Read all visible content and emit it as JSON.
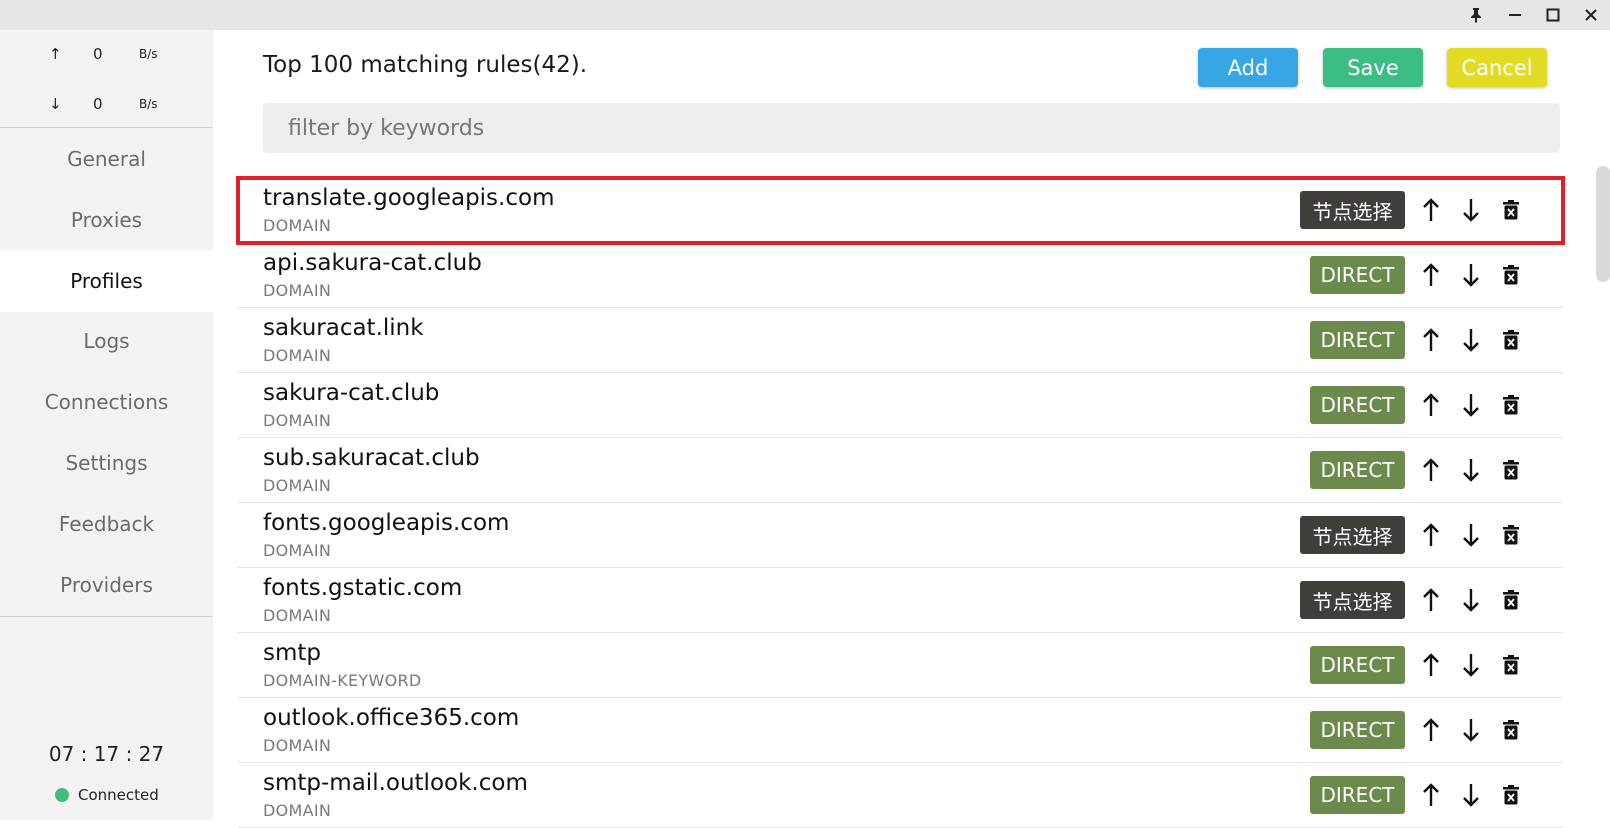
{
  "window": {
    "buttons": {
      "pin": "pin-icon",
      "minimize": "minimize-icon",
      "maximize": "maximize-icon",
      "close": "close-icon"
    }
  },
  "traffic": {
    "up": {
      "arrow": "↑",
      "value": "0",
      "unit": "B/s"
    },
    "down": {
      "arrow": "↓",
      "value": "0",
      "unit": "B/s"
    }
  },
  "nav": {
    "items": [
      "General",
      "Proxies",
      "Profiles",
      "Logs",
      "Connections",
      "Settings",
      "Feedback",
      "Providers"
    ],
    "active": "Profiles"
  },
  "footer": {
    "time": "07 : 17 : 27",
    "status": "Connected",
    "status_color": "#3fbf7a"
  },
  "header": {
    "title": "Top 100 matching rules(42).",
    "add_label": "Add",
    "save_label": "Save",
    "cancel_label": "Cancel",
    "add_color": "#36a7e4",
    "save_color": "#3dbd86",
    "cancel_color": "#e3dc24"
  },
  "search": {
    "placeholder": "filter by keywords",
    "value": ""
  },
  "rules": [
    {
      "payload": "translate.googleapis.com",
      "type": "DOMAIN",
      "policy": "节点选择",
      "highlighted": true
    },
    {
      "payload": "api.sakura-cat.club",
      "type": "DOMAIN",
      "policy": "DIRECT"
    },
    {
      "payload": "sakuracat.link",
      "type": "DOMAIN",
      "policy": "DIRECT"
    },
    {
      "payload": "sakura-cat.club",
      "type": "DOMAIN",
      "policy": "DIRECT"
    },
    {
      "payload": "sub.sakuracat.club",
      "type": "DOMAIN",
      "policy": "DIRECT"
    },
    {
      "payload": "fonts.googleapis.com",
      "type": "DOMAIN",
      "policy": "节点选择"
    },
    {
      "payload": "fonts.gstatic.com",
      "type": "DOMAIN",
      "policy": "节点选择"
    },
    {
      "payload": "smtp",
      "type": "DOMAIN-KEYWORD",
      "policy": "DIRECT"
    },
    {
      "payload": "outlook.office365.com",
      "type": "DOMAIN",
      "policy": "DIRECT"
    },
    {
      "payload": "smtp-mail.outlook.com",
      "type": "DOMAIN",
      "policy": "DIRECT"
    }
  ],
  "colors": {
    "direct": "#6b8a4b",
    "node": "#403e3a",
    "highlight": "#e0212b"
  }
}
